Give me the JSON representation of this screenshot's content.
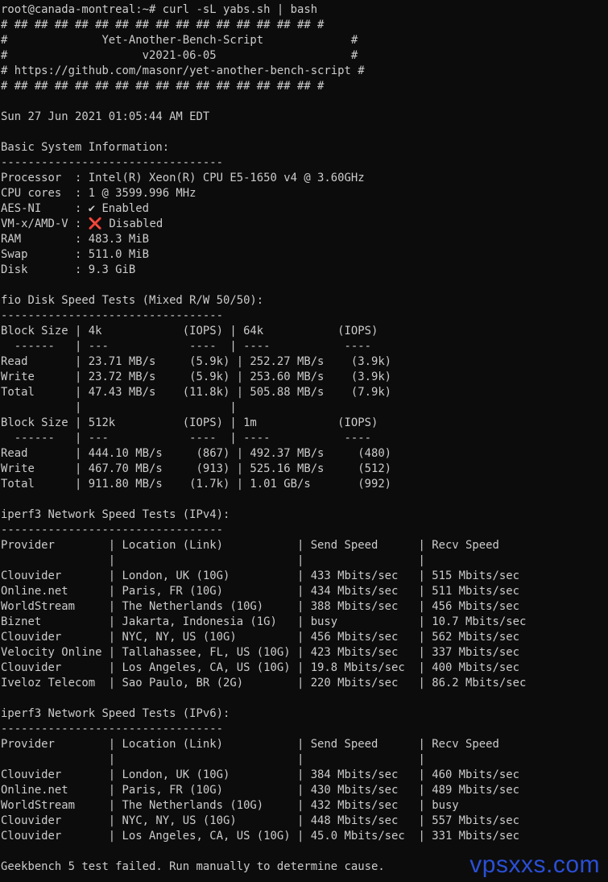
{
  "terminal": {
    "lines": [
      "root@canada-montreal:~# curl -sL yabs.sh | bash",
      "# ## ## ## ## ## ## ## ## ## ## ## ## ## ## ## #",
      "#              Yet-Another-Bench-Script             #",
      "#                    v2021-06-05                    #",
      "# https://github.com/masonr/yet-another-bench-script #",
      "# ## ## ## ## ## ## ## ## ## ## ## ## ## ## ## #",
      "",
      "Sun 27 Jun 2021 01:05:44 AM EDT",
      "",
      "Basic System Information:",
      "---------------------------------",
      "Processor  : Intel(R) Xeon(R) CPU E5-1650 v4 @ 3.60GHz",
      "CPU cores  : 1 @ 3599.996 MHz",
      "AES-NI     : ✔ Enabled",
      "VM-x/AMD-V : ❌ Disabled",
      "RAM        : 483.3 MiB",
      "Swap       : 511.0 MiB",
      "Disk       : 9.3 GiB",
      "",
      "fio Disk Speed Tests (Mixed R/W 50/50):",
      "---------------------------------",
      "Block Size | 4k            (IOPS) | 64k           (IOPS)",
      "  ------   | ---            ----  | ----           ----",
      "Read       | 23.71 MB/s     (5.9k) | 252.27 MB/s    (3.9k)",
      "Write      | 23.72 MB/s     (5.9k) | 253.60 MB/s    (3.9k)",
      "Total      | 47.43 MB/s    (11.8k) | 505.88 MB/s    (7.9k)",
      "           |                      |",
      "Block Size | 512k          (IOPS) | 1m            (IOPS)",
      "  ------   | ---            ----  | ----           ----",
      "Read       | 444.10 MB/s     (867) | 492.37 MB/s     (480)",
      "Write      | 467.70 MB/s     (913) | 525.16 MB/s     (512)",
      "Total      | 911.80 MB/s    (1.7k) | 1.01 GB/s       (992)",
      "",
      "iperf3 Network Speed Tests (IPv4):",
      "---------------------------------",
      "Provider        | Location (Link)           | Send Speed      | Recv Speed",
      "                |                           |                 |",
      "Clouvider       | London, UK (10G)          | 433 Mbits/sec   | 515 Mbits/sec",
      "Online.net      | Paris, FR (10G)           | 434 Mbits/sec   | 511 Mbits/sec",
      "WorldStream     | The Netherlands (10G)     | 388 Mbits/sec   | 456 Mbits/sec",
      "Biznet          | Jakarta, Indonesia (1G)   | busy            | 10.7 Mbits/sec",
      "Clouvider       | NYC, NY, US (10G)         | 456 Mbits/sec   | 562 Mbits/sec",
      "Velocity Online | Tallahassee, FL, US (10G) | 423 Mbits/sec   | 337 Mbits/sec",
      "Clouvider       | Los Angeles, CA, US (10G) | 19.8 Mbits/sec  | 400 Mbits/sec",
      "Iveloz Telecom  | Sao Paulo, BR (2G)        | 220 Mbits/sec   | 86.2 Mbits/sec",
      "",
      "iperf3 Network Speed Tests (IPv6):",
      "---------------------------------",
      "Provider        | Location (Link)           | Send Speed      | Recv Speed",
      "                |                           |                 |",
      "Clouvider       | London, UK (10G)          | 384 Mbits/sec   | 460 Mbits/sec",
      "Online.net      | Paris, FR (10G)           | 430 Mbits/sec   | 489 Mbits/sec",
      "WorldStream     | The Netherlands (10G)     | 432 Mbits/sec   | busy",
      "Clouvider       | NYC, NY, US (10G)         | 448 Mbits/sec   | 557 Mbits/sec",
      "Clouvider       | Los Angeles, CA, US (10G) | 45.0 Mbits/sec  | 331 Mbits/sec",
      "",
      "Geekbench 5 test failed. Run manually to determine cause."
    ]
  },
  "watermark": {
    "text": "vpsxxs.com",
    "color": "#2a4fd6"
  },
  "colors": {
    "background": "#0c0c0c",
    "foreground": "#cccccc"
  }
}
